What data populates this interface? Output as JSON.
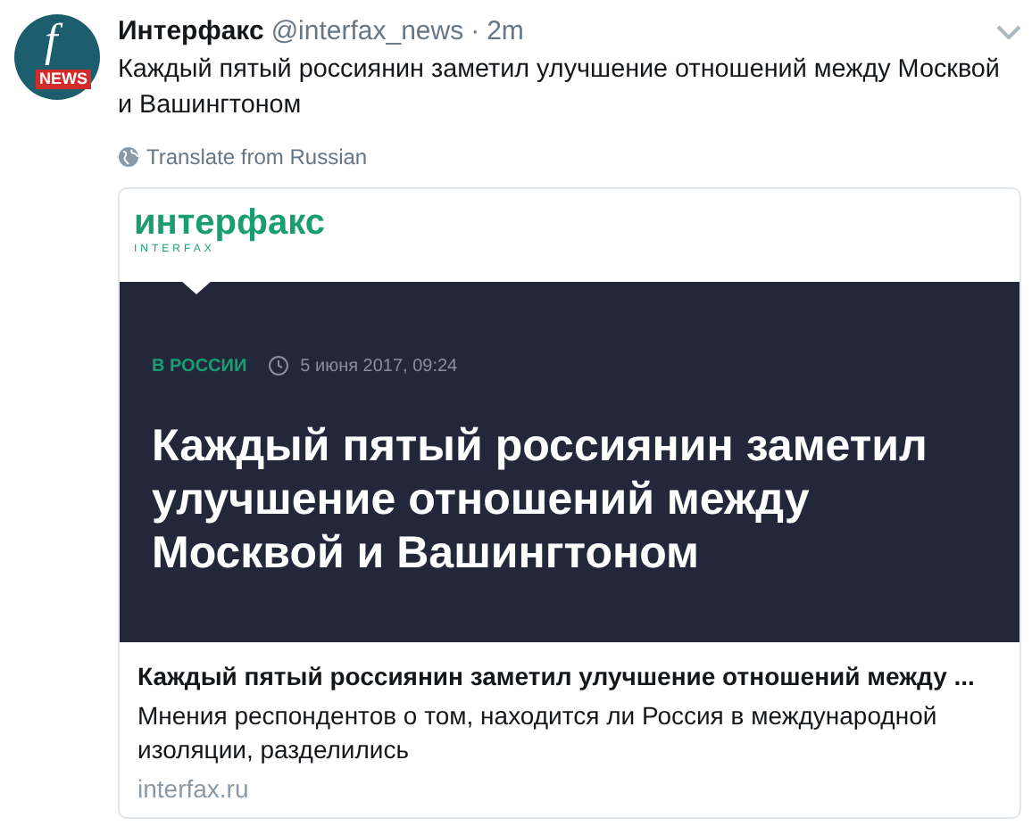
{
  "tweet": {
    "avatar": {
      "letter": "f",
      "badge": "NEWS"
    },
    "author": "Интерфакс",
    "handle": "@interfax_news",
    "separator": "·",
    "time": "2m",
    "text": "Каждый пятый россиянин заметил улучшение отношений между Москвой и Вашингтоном",
    "translate": "Translate from Russian"
  },
  "card": {
    "image": {
      "logo": "интерфакс",
      "logo_sub": "INTERFAX",
      "category": "В РОССИИ",
      "date": "5 июня 2017, 09:24",
      "headline": "Каждый пятый россиянин заметил улучшение отношений между Москвой и Вашингтоном"
    },
    "title": "Каждый пятый россиянин заметил улучшение отношений между ...",
    "description": "Мнения респондентов о том, находится ли Россия в международной изоляции, разделились",
    "domain": "interfax.ru"
  }
}
